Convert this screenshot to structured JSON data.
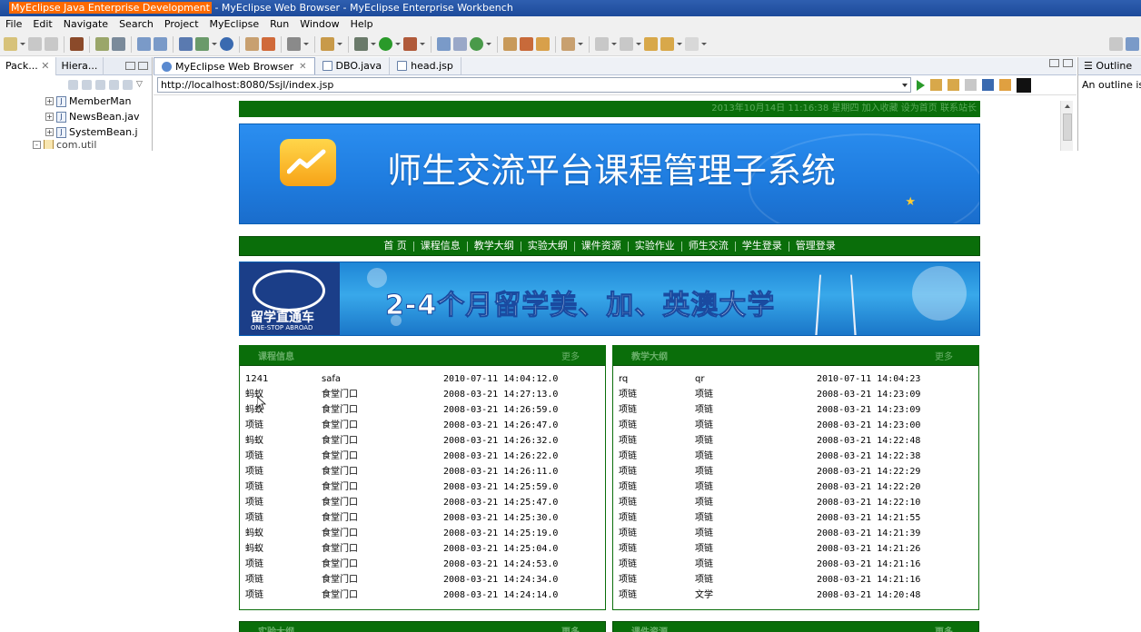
{
  "window": {
    "title_prefix": "MyEclipse Java Enterprise Development",
    "title_rest": " - MyEclipse Web Browser - MyEclipse Enterprise Workbench"
  },
  "menu": [
    "File",
    "Edit",
    "Navigate",
    "Search",
    "Project",
    "MyEclipse",
    "Run",
    "Window",
    "Help"
  ],
  "left_views": {
    "tabs": [
      "Pack...",
      "Hiera..."
    ],
    "tree": [
      "MemberMan",
      "NewsBean.jav",
      "SystemBean.j",
      "com.util"
    ]
  },
  "editor": {
    "tabs": [
      "MyEclipse Web Browser",
      "DBO.java",
      "head.jsp"
    ],
    "url": "http://localhost:8080/Ssjl/index.jsp"
  },
  "outline": {
    "title": "Outline",
    "body": "An outline is"
  },
  "site": {
    "top_strip": "2013年10月14日 11:16:38  星期四    加入收藏  设为首页  联系站长",
    "banner_title": "师生交流平台课程管理子系统",
    "nav": [
      "首 页",
      "课程信息",
      "教学大纲",
      "实验大纲",
      "课件资源",
      "实验作业",
      "师生交流",
      "学生登录",
      "管理登录"
    ],
    "ad_slogan": "2-4个月留学美、加、英澳大学",
    "ad_brand": "留学直通车",
    "ad_brand_en": "ONE-STOP ABROAD",
    "more": "更多",
    "box_course": {
      "title": "课程信息",
      "rows": [
        {
          "a": "1241",
          "b": "safa",
          "t": "2010-07-11 14:04:12.0"
        },
        {
          "a": "蚂蚁",
          "b": "食堂门口",
          "t": "2008-03-21 14:27:13.0"
        },
        {
          "a": "蚂蚁",
          "b": "食堂门口",
          "t": "2008-03-21 14:26:59.0"
        },
        {
          "a": "项链",
          "b": "食堂门口",
          "t": "2008-03-21 14:26:47.0"
        },
        {
          "a": "蚂蚁",
          "b": "食堂门口",
          "t": "2008-03-21 14:26:32.0"
        },
        {
          "a": "项链",
          "b": "食堂门口",
          "t": "2008-03-21 14:26:22.0"
        },
        {
          "a": "项链",
          "b": "食堂门口",
          "t": "2008-03-21 14:26:11.0"
        },
        {
          "a": "项链",
          "b": "食堂门口",
          "t": "2008-03-21 14:25:59.0"
        },
        {
          "a": "项链",
          "b": "食堂门口",
          "t": "2008-03-21 14:25:47.0"
        },
        {
          "a": "项链",
          "b": "食堂门口",
          "t": "2008-03-21 14:25:30.0"
        },
        {
          "a": "蚂蚁",
          "b": "食堂门口",
          "t": "2008-03-21 14:25:19.0"
        },
        {
          "a": "蚂蚁",
          "b": "食堂门口",
          "t": "2008-03-21 14:25:04.0"
        },
        {
          "a": "项链",
          "b": "食堂门口",
          "t": "2008-03-21 14:24:53.0"
        },
        {
          "a": "项链",
          "b": "食堂门口",
          "t": "2008-03-21 14:24:34.0"
        },
        {
          "a": "项链",
          "b": "食堂门口",
          "t": "2008-03-21 14:24:14.0"
        }
      ]
    },
    "box_syllabus": {
      "title": "教学大纲",
      "rows": [
        {
          "a": "rq",
          "b": "qr",
          "t": "2010-07-11 14:04:23"
        },
        {
          "a": "项链",
          "b": "项链",
          "t": "2008-03-21 14:23:09"
        },
        {
          "a": "项链",
          "b": "项链",
          "t": "2008-03-21 14:23:09"
        },
        {
          "a": "项链",
          "b": "项链",
          "t": "2008-03-21 14:23:00"
        },
        {
          "a": "项链",
          "b": "项链",
          "t": "2008-03-21 14:22:48"
        },
        {
          "a": "项链",
          "b": "项链",
          "t": "2008-03-21 14:22:38"
        },
        {
          "a": "项链",
          "b": "项链",
          "t": "2008-03-21 14:22:29"
        },
        {
          "a": "项链",
          "b": "项链",
          "t": "2008-03-21 14:22:20"
        },
        {
          "a": "项链",
          "b": "项链",
          "t": "2008-03-21 14:22:10"
        },
        {
          "a": "项链",
          "b": "项链",
          "t": "2008-03-21 14:21:55"
        },
        {
          "a": "项链",
          "b": "项链",
          "t": "2008-03-21 14:21:39"
        },
        {
          "a": "项链",
          "b": "项链",
          "t": "2008-03-21 14:21:26"
        },
        {
          "a": "项链",
          "b": "项链",
          "t": "2008-03-21 14:21:16"
        },
        {
          "a": "项链",
          "b": "项链",
          "t": "2008-03-21 14:21:16"
        },
        {
          "a": "项链",
          "b": "文学",
          "t": "2008-03-21 14:20:48"
        }
      ]
    },
    "box_lab": {
      "title": "实验大纲"
    },
    "box_resource": {
      "title": "课件资源"
    }
  },
  "colors": {
    "site_green": "#0a6e0a",
    "banner_blue": "#1f7de0",
    "title_bar": "#1d4a9a"
  }
}
